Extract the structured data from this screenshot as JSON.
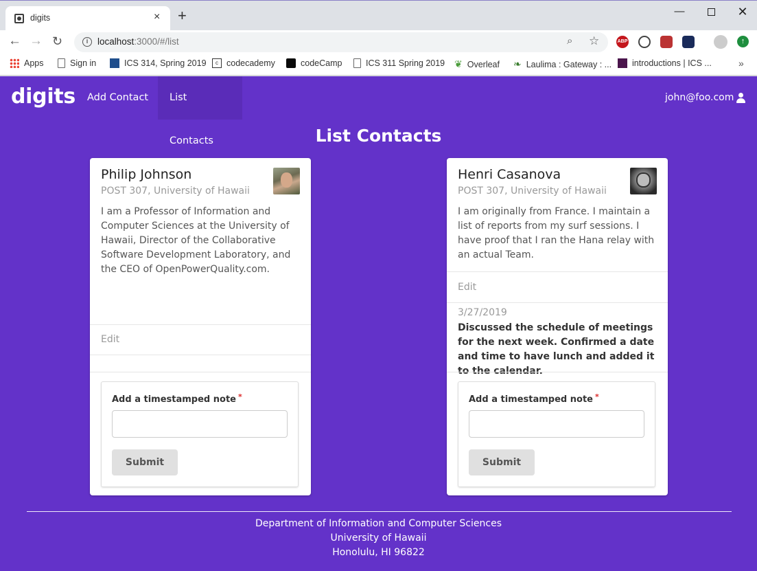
{
  "browser": {
    "tab_title": "digits",
    "tab_close": "×",
    "new_tab": "+",
    "url_host": "localhost",
    "url_rest": ":3000/#/list",
    "window_controls": {
      "minimize": "—",
      "maximize": "",
      "close": "✕"
    },
    "nav": {
      "back": "←",
      "forward": "→",
      "reload": "↻"
    },
    "icons": [
      "info-icon",
      "zoom-icon",
      "star-icon",
      "adblock-plus-icon",
      "extension-icon",
      "profile-icon",
      "update-icon"
    ],
    "abp_text": "ABP",
    "bookmarks": [
      {
        "label": "Apps",
        "icon": "apps-grid-icon"
      },
      {
        "label": "Sign in",
        "icon": "page-icon"
      },
      {
        "label": "ICS 314, Spring 2019",
        "icon": "ics-icon"
      },
      {
        "label": "codecademy",
        "icon": "codecademy-icon"
      },
      {
        "label": "codeCamp",
        "icon": "freecodecamp-icon"
      },
      {
        "label": "ICS 311 Spring 2019",
        "icon": "page-icon"
      },
      {
        "label": "Overleaf",
        "icon": "overleaf-icon"
      },
      {
        "label": "Laulima : Gateway : ...",
        "icon": "laulima-icon"
      },
      {
        "label": "introductions | ICS ...",
        "icon": "slack-icon"
      }
    ],
    "bookmarks_more": "»"
  },
  "app": {
    "brand": "digits",
    "nav": {
      "add_contact": "Add Contact",
      "list_contacts": "List Contacts"
    },
    "user_email": "john@foo.com",
    "accent_color": "#6332c9",
    "page_title": "List Contacts",
    "contacts": [
      {
        "name": "Philip Johnson",
        "address": "POST 307, University of Hawaii",
        "description": "I am a Professor of Information and Computer Sciences at the University of Hawaii, Director of the Collaborative Software Development Laboratory, and the CEO of OpenPowerQuality.com.",
        "edit_label": "Edit",
        "notes": [],
        "form": {
          "label": "Add a timestamped note",
          "required_mark": "*",
          "value": "",
          "submit": "Submit"
        }
      },
      {
        "name": "Henri Casanova",
        "address": "POST 307, University of Hawaii",
        "description": "I am originally from France. I maintain a list of reports from my surf sessions. I have proof that I ran the Hana relay with an actual Team.",
        "edit_label": "Edit",
        "notes": [
          {
            "date": "3/27/2019",
            "text": "Discussed the schedule of meetings for the next week. Confirmed a date and time to have lunch and added it to the calendar."
          }
        ],
        "form": {
          "label": "Add a timestamped note",
          "required_mark": "*",
          "value": "",
          "submit": "Submit"
        }
      }
    ],
    "footer": {
      "line1": "Department of Information and Computer Sciences",
      "line2": "University of Hawaii",
      "line3": "Honolulu, HI 96822"
    }
  }
}
